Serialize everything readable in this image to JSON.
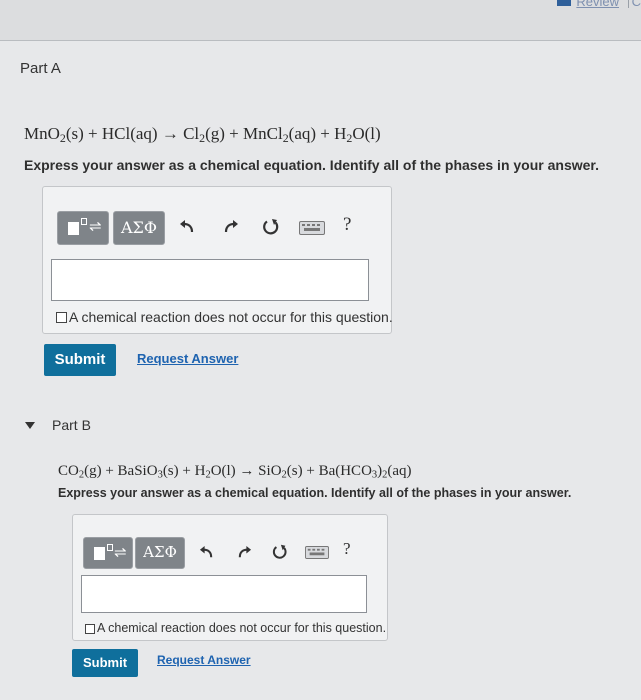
{
  "header": {
    "review_link": "Review",
    "right_fragment": "C"
  },
  "part_a": {
    "title": "Part A",
    "equation": {
      "lhs": [
        "MnO",
        "2",
        "(s) + HCl(aq) → Cl",
        "2",
        "(g) + MnCl",
        "2",
        "(aq) + H",
        "2",
        "O(l)"
      ]
    },
    "instruction": "Express your answer as a chemical equation. Identify all of the phases in your answer.",
    "toolbar": {
      "greek_label": "ΑΣΦ",
      "help_label": "?"
    },
    "input_value": "",
    "no_reaction_label": "A chemical reaction does not occur for this question.",
    "no_reaction_checked": false,
    "submit_label": "Submit",
    "request_label": "Request Answer"
  },
  "part_b": {
    "title": "Part B",
    "equation": {
      "lhs": [
        "CO",
        "2",
        "(g) + BaSiO",
        "3",
        "(s) + H",
        "2",
        "O(l) → SiO",
        "2",
        "(s) + Ba(HCO",
        "3",
        ")",
        "2",
        "(aq)"
      ]
    },
    "instruction": "Express your answer as a chemical equation. Identify all of the phases in your answer.",
    "toolbar": {
      "greek_label": "ΑΣΦ",
      "help_label": "?"
    },
    "input_value": "",
    "no_reaction_label": "A chemical reaction does not occur for this question.",
    "no_reaction_checked": false,
    "submit_label": "Submit",
    "request_label": "Request Answer"
  },
  "colors": {
    "accent": "#0f6f9c",
    "link": "#1e63b0",
    "tool_button": "#7f8489"
  }
}
